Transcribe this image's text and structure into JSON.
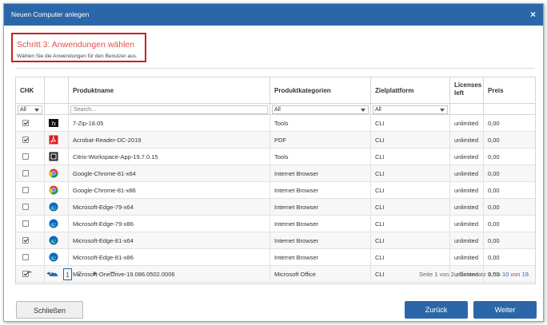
{
  "dialog": {
    "title": "Neuen Computer anlegen",
    "close_glyph": "×"
  },
  "step": {
    "title": "Schritt 3: Anwendungen wählen",
    "subtitle": "Wählen Sie die Anwendungen für den Benutzer aus."
  },
  "table": {
    "headers": {
      "chk": "CHK",
      "name": "Produktname",
      "category": "Produktkategorien",
      "platform": "Zielplattform",
      "licenses_line1": "Licenses",
      "licenses_line2": "left",
      "price": "Preis"
    },
    "filters": {
      "chk": "All",
      "name_placeholder": "Search...",
      "category": "All",
      "platform": "All"
    },
    "rows": [
      {
        "checked": true,
        "icon": "7zip-icon",
        "name": "7-Zip-18.05",
        "category": "Tools",
        "platform": "CLI",
        "licenses": "unlimited",
        "price": "0,00"
      },
      {
        "checked": true,
        "icon": "pdf-icon",
        "name": "Acrobat-Reader-DC-2019",
        "category": "PDF",
        "platform": "CLI",
        "licenses": "unlimited",
        "price": "0,00"
      },
      {
        "checked": false,
        "icon": "citrix-icon",
        "name": "Citrix-Workspace-App-19.7.0.15",
        "category": "Tools",
        "platform": "CLI",
        "licenses": "unlimited",
        "price": "0,00"
      },
      {
        "checked": false,
        "icon": "chrome-icon",
        "name": "Google-Chrome-81-x64",
        "category": "Internet Browser",
        "platform": "CLI",
        "licenses": "unlimited",
        "price": "0,00"
      },
      {
        "checked": false,
        "icon": "chrome-icon",
        "name": "Google-Chrome-81-x86",
        "category": "Internet Browser",
        "platform": "CLI",
        "licenses": "unlimited",
        "price": "0,00"
      },
      {
        "checked": false,
        "icon": "edge-icon",
        "name": "Microsoft-Edge-79-x64",
        "category": "Internet Browser",
        "platform": "CLI",
        "licenses": "unlimited",
        "price": "0,00"
      },
      {
        "checked": false,
        "icon": "edge-icon",
        "name": "Microsoft-Edge-79-x86",
        "category": "Internet Browser",
        "platform": "CLI",
        "licenses": "unlimited",
        "price": "0,00"
      },
      {
        "checked": true,
        "icon": "edge-icon",
        "name": "Microsoft-Edge-81-x64",
        "category": "Internet Browser",
        "platform": "CLI",
        "licenses": "unlimited",
        "price": "0,00"
      },
      {
        "checked": false,
        "icon": "edge-icon",
        "name": "Microsoft-Edge-81-x86",
        "category": "Internet Browser",
        "platform": "CLI",
        "licenses": "unlimited",
        "price": "0,00"
      },
      {
        "checked": true,
        "icon": "onedrive-icon",
        "name": "Microsoft-OneDrive-19.086.0502.0006",
        "category": "Microsoft Office",
        "platform": "CLI",
        "licenses": "unlimited",
        "price": "0,00"
      }
    ]
  },
  "pager": {
    "first": "⏮",
    "prev": "◀",
    "next": "▶",
    "last": "⏭",
    "pages": [
      "1",
      "2"
    ],
    "current_page": "1",
    "info_prefix": "Seite",
    "page": "1",
    "info_of": "von",
    "total_pages": "2.",
    "info_records": "Datensatz",
    "from": "1",
    "info_to": "bis",
    "to": "10",
    "info_of2": "von",
    "total": "19."
  },
  "buttons": {
    "close": "Schließen",
    "back": "Zurück",
    "next": "Weiter"
  },
  "colors": {
    "accent": "#2b67a8",
    "step_title": "#d9534f",
    "highlight_border": "#cc1f1f"
  }
}
